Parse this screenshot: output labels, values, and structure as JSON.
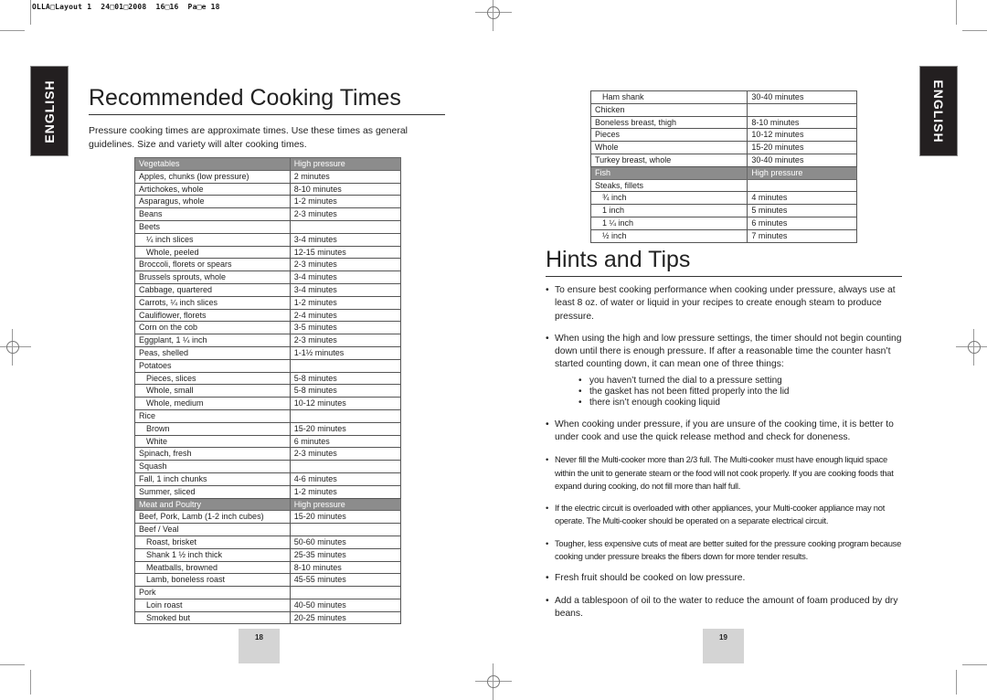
{
  "print_slug": "OLLA□Layout 1  24□01□2008  16□16  Pa□e 18",
  "language_tab": "ENGLISH",
  "left_page": {
    "title": "Recommended Cooking Times",
    "intro": "Pressure cooking times are approximate times. Use these times as general guidelines. Size and variety will alter cooking times.",
    "table": [
      {
        "type": "header",
        "item": "Vegetables",
        "time": "High pressure"
      },
      {
        "item": "Apples, chunks (low pressure)",
        "time": "2 minutes"
      },
      {
        "item": "Artichokes, whole",
        "time": "8-10 minutes"
      },
      {
        "item": "Asparagus, whole",
        "time": "1-2 minutes"
      },
      {
        "item": "Beans",
        "time": "2-3 minutes"
      },
      {
        "item": "Beets",
        "time": ""
      },
      {
        "item": "¼ inch slices",
        "time": "3-4 minutes",
        "indent": true
      },
      {
        "item": "Whole, peeled",
        "time": "12-15 minutes",
        "indent": true
      },
      {
        "item": "Broccoli, florets or spears",
        "time": "2-3 minutes"
      },
      {
        "item": "Brussels sprouts, whole",
        "time": "3-4 minutes"
      },
      {
        "item": "Cabbage, quartered",
        "time": "3-4 minutes"
      },
      {
        "item": "Carrots, ¼ inch slices",
        "time": "1-2 minutes"
      },
      {
        "item": "Cauliflower, florets",
        "time": "2-4 minutes"
      },
      {
        "item": "Corn on the cob",
        "time": "3-5 minutes"
      },
      {
        "item": "Eggplant, 1 ¼ inch",
        "time": "2-3 minutes"
      },
      {
        "item": "Peas, shelled",
        "time": "1-1½ minutes"
      },
      {
        "item": "Potatoes",
        "time": ""
      },
      {
        "item": "Pieces, slices",
        "time": "5-8 minutes",
        "indent": true
      },
      {
        "item": "Whole, small",
        "time": "5-8 minutes",
        "indent": true
      },
      {
        "item": "Whole, medium",
        "time": "10-12 minutes",
        "indent": true
      },
      {
        "item": "Rice",
        "time": ""
      },
      {
        "item": "Brown",
        "time": "15-20 minutes",
        "indent": true
      },
      {
        "item": "White",
        "time": "6 minutes",
        "indent": true
      },
      {
        "item": "Spinach, fresh",
        "time": "2-3 minutes"
      },
      {
        "item": "Squash",
        "time": ""
      },
      {
        "item": "Fall, 1 inch chunks",
        "time": "4-6 minutes"
      },
      {
        "item": "Summer, sliced",
        "time": "1-2 minutes"
      },
      {
        "type": "header",
        "item": "Meat and Poultry",
        "time": "High pressure"
      },
      {
        "item": "Beef, Pork, Lamb (1-2 inch cubes)",
        "time": "15-20 minutes"
      },
      {
        "item": "Beef / Veal",
        "time": ""
      },
      {
        "item": "Roast, brisket",
        "time": "50-60 minutes",
        "indent": true
      },
      {
        "item": "Shank 1 ½ inch thick",
        "time": "25-35 minutes",
        "indent": true
      },
      {
        "item": "Meatballs, browned",
        "time": "8-10 minutes",
        "indent": true
      },
      {
        "item": "Lamb, boneless roast",
        "time": "45-55 minutes",
        "indent": true
      },
      {
        "item": "Pork",
        "time": ""
      },
      {
        "item": "Loin roast",
        "time": "40-50 minutes",
        "indent": true
      },
      {
        "item": "Smoked but",
        "time": "20-25 minutes",
        "indent": true
      }
    ],
    "page_number": "18"
  },
  "right_page": {
    "table": [
      {
        "item": "Ham shank",
        "time": "30-40 minutes",
        "indent": true
      },
      {
        "item": "Chicken",
        "time": ""
      },
      {
        "item": "Boneless breast, thigh",
        "time": "8-10 minutes"
      },
      {
        "item": "Pieces",
        "time": "10-12 minutes"
      },
      {
        "item": "Whole",
        "time": "15-20 minutes"
      },
      {
        "item": "Turkey breast, whole",
        "time": "30-40 minutes"
      },
      {
        "type": "header",
        "item": "Fish",
        "time": "High pressure"
      },
      {
        "item": "Steaks, fillets",
        "time": ""
      },
      {
        "item": "¾ inch",
        "time": "4 minutes",
        "indent": true
      },
      {
        "item": "1 inch",
        "time": "5 minutes",
        "indent": true
      },
      {
        "item": "1 ¼ inch",
        "time": "6 minutes",
        "indent": true
      },
      {
        "item": "½ inch",
        "time": "7 minutes",
        "indent": true
      }
    ],
    "hints_title": "Hints and Tips",
    "bullet": "•",
    "tips": [
      {
        "text": "To ensure best cooking performance when cooking under pressure, always use at least 8 oz. of water or liquid in your recipes to create enough steam to produce pressure."
      },
      {
        "text": "When using the high and low pressure settings, the timer should not begin counting down until there is enough pressure. If after a reasonable time the counter hasn’t started counting down, it can mean one of three things:",
        "sub": [
          "you haven’t turned the dial to a pressure setting",
          "the gasket has not been fitted properly into the lid",
          "there isn’t enough cooking liquid"
        ]
      },
      {
        "text": "When cooking under pressure, if you are unsure of the cooking time, it is better to under cook and use the quick release method and check for doneness."
      },
      {
        "text": "Never fill the Multi-cooker more than 2/3 full. The Multi-cooker must have enough liquid space within the unit to generate steam or the food will not cook properly. If you are cooking foods that expand during cooking, do not fill more than half full."
      },
      {
        "text": "If the electric circuit is overloaded with other appliances, your Multi-cooker appliance may not operate. The Multi-cooker should be operated on a separate electrical circuit."
      },
      {
        "text": "Tougher, less expensive cuts of meat are better suited for the pressure cooking program because cooking under pressure breaks the fibers down for more tender results."
      },
      {
        "text": "Fresh fruit should be cooked on low pressure."
      },
      {
        "text": "Add a tablespoon of oil to the water to reduce the amount of foam produced by dry beans."
      }
    ],
    "page_number": "19"
  },
  "colors": {
    "header_row_bg": "#8c8c8c",
    "language_tab_bg": "#231f20",
    "page_number_bg": "#d4d4d4"
  }
}
